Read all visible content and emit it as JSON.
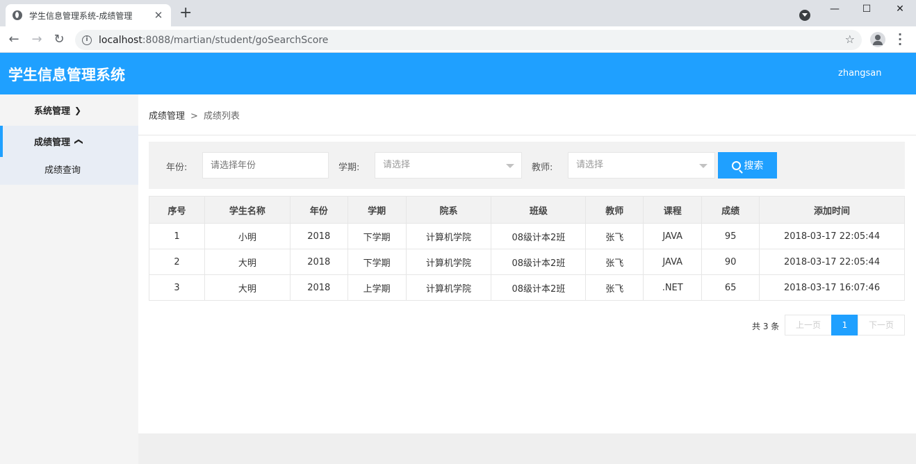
{
  "browser": {
    "tab_title": "学生信息管理系统-成绩管理",
    "url_host": "localhost",
    "url_rest": ":8088/martian/student/goSearchScore"
  },
  "header": {
    "title": "学生信息管理系统",
    "user": "zhangsan"
  },
  "sidebar": {
    "groups": [
      {
        "label": "系统管理",
        "expanded": false
      },
      {
        "label": "成绩管理",
        "expanded": true,
        "items": [
          {
            "label": "成绩查询"
          }
        ]
      }
    ]
  },
  "breadcrumb": {
    "parent": "成绩管理",
    "separator": ">",
    "current": "成绩列表"
  },
  "search": {
    "year_label": "年份:",
    "year_placeholder": "请选择年份",
    "term_label": "学期:",
    "term_value": "请选择",
    "teacher_label": "教师:",
    "teacher_value": "请选择",
    "button_label": "搜索"
  },
  "table": {
    "headers": [
      "序号",
      "学生名称",
      "年份",
      "学期",
      "院系",
      "班级",
      "教师",
      "课程",
      "成绩",
      "添加时间"
    ],
    "rows": [
      [
        "1",
        "小明",
        "2018",
        "下学期",
        "计算机学院",
        "08级计本2班",
        "张飞",
        "JAVA",
        "95",
        "2018-03-17 22:05:44"
      ],
      [
        "2",
        "大明",
        "2018",
        "下学期",
        "计算机学院",
        "08级计本2班",
        "张飞",
        "JAVA",
        "90",
        "2018-03-17 22:05:44"
      ],
      [
        "3",
        "大明",
        "2018",
        "上学期",
        "计算机学院",
        "08级计本2班",
        "张飞",
        ".NET",
        "65",
        "2018-03-17 16:07:46"
      ]
    ]
  },
  "pagination": {
    "total": "共 3 条",
    "prev": "上一页",
    "current": "1",
    "next": "下一页"
  },
  "colors": {
    "accent": "#1fa0ff",
    "sidebar_bg": "#f4f4f4",
    "panel_bg": "#f2f2f2"
  }
}
